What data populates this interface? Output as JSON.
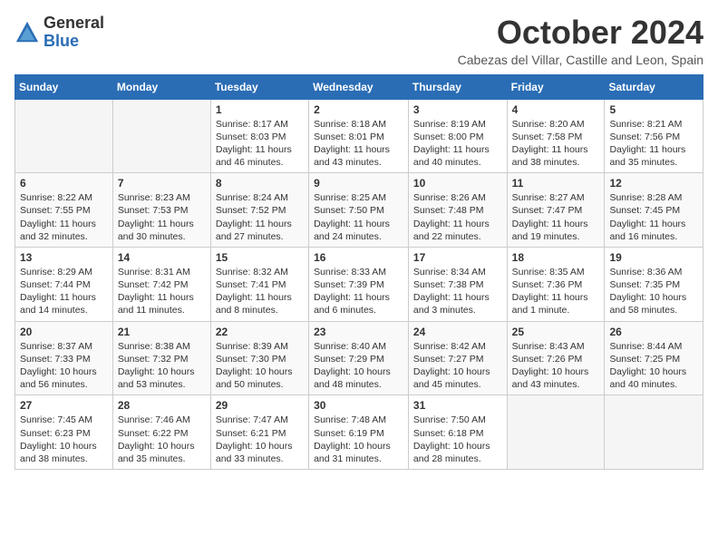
{
  "header": {
    "logo_general": "General",
    "logo_blue": "Blue",
    "month_title": "October 2024",
    "location": "Cabezas del Villar, Castille and Leon, Spain"
  },
  "days_of_week": [
    "Sunday",
    "Monday",
    "Tuesday",
    "Wednesday",
    "Thursday",
    "Friday",
    "Saturday"
  ],
  "weeks": [
    [
      {
        "day": "",
        "info": ""
      },
      {
        "day": "",
        "info": ""
      },
      {
        "day": "1",
        "info": "Sunrise: 8:17 AM\nSunset: 8:03 PM\nDaylight: 11 hours and 46 minutes."
      },
      {
        "day": "2",
        "info": "Sunrise: 8:18 AM\nSunset: 8:01 PM\nDaylight: 11 hours and 43 minutes."
      },
      {
        "day": "3",
        "info": "Sunrise: 8:19 AM\nSunset: 8:00 PM\nDaylight: 11 hours and 40 minutes."
      },
      {
        "day": "4",
        "info": "Sunrise: 8:20 AM\nSunset: 7:58 PM\nDaylight: 11 hours and 38 minutes."
      },
      {
        "day": "5",
        "info": "Sunrise: 8:21 AM\nSunset: 7:56 PM\nDaylight: 11 hours and 35 minutes."
      }
    ],
    [
      {
        "day": "6",
        "info": "Sunrise: 8:22 AM\nSunset: 7:55 PM\nDaylight: 11 hours and 32 minutes."
      },
      {
        "day": "7",
        "info": "Sunrise: 8:23 AM\nSunset: 7:53 PM\nDaylight: 11 hours and 30 minutes."
      },
      {
        "day": "8",
        "info": "Sunrise: 8:24 AM\nSunset: 7:52 PM\nDaylight: 11 hours and 27 minutes."
      },
      {
        "day": "9",
        "info": "Sunrise: 8:25 AM\nSunset: 7:50 PM\nDaylight: 11 hours and 24 minutes."
      },
      {
        "day": "10",
        "info": "Sunrise: 8:26 AM\nSunset: 7:48 PM\nDaylight: 11 hours and 22 minutes."
      },
      {
        "day": "11",
        "info": "Sunrise: 8:27 AM\nSunset: 7:47 PM\nDaylight: 11 hours and 19 minutes."
      },
      {
        "day": "12",
        "info": "Sunrise: 8:28 AM\nSunset: 7:45 PM\nDaylight: 11 hours and 16 minutes."
      }
    ],
    [
      {
        "day": "13",
        "info": "Sunrise: 8:29 AM\nSunset: 7:44 PM\nDaylight: 11 hours and 14 minutes."
      },
      {
        "day": "14",
        "info": "Sunrise: 8:31 AM\nSunset: 7:42 PM\nDaylight: 11 hours and 11 minutes."
      },
      {
        "day": "15",
        "info": "Sunrise: 8:32 AM\nSunset: 7:41 PM\nDaylight: 11 hours and 8 minutes."
      },
      {
        "day": "16",
        "info": "Sunrise: 8:33 AM\nSunset: 7:39 PM\nDaylight: 11 hours and 6 minutes."
      },
      {
        "day": "17",
        "info": "Sunrise: 8:34 AM\nSunset: 7:38 PM\nDaylight: 11 hours and 3 minutes."
      },
      {
        "day": "18",
        "info": "Sunrise: 8:35 AM\nSunset: 7:36 PM\nDaylight: 11 hours and 1 minute."
      },
      {
        "day": "19",
        "info": "Sunrise: 8:36 AM\nSunset: 7:35 PM\nDaylight: 10 hours and 58 minutes."
      }
    ],
    [
      {
        "day": "20",
        "info": "Sunrise: 8:37 AM\nSunset: 7:33 PM\nDaylight: 10 hours and 56 minutes."
      },
      {
        "day": "21",
        "info": "Sunrise: 8:38 AM\nSunset: 7:32 PM\nDaylight: 10 hours and 53 minutes."
      },
      {
        "day": "22",
        "info": "Sunrise: 8:39 AM\nSunset: 7:30 PM\nDaylight: 10 hours and 50 minutes."
      },
      {
        "day": "23",
        "info": "Sunrise: 8:40 AM\nSunset: 7:29 PM\nDaylight: 10 hours and 48 minutes."
      },
      {
        "day": "24",
        "info": "Sunrise: 8:42 AM\nSunset: 7:27 PM\nDaylight: 10 hours and 45 minutes."
      },
      {
        "day": "25",
        "info": "Sunrise: 8:43 AM\nSunset: 7:26 PM\nDaylight: 10 hours and 43 minutes."
      },
      {
        "day": "26",
        "info": "Sunrise: 8:44 AM\nSunset: 7:25 PM\nDaylight: 10 hours and 40 minutes."
      }
    ],
    [
      {
        "day": "27",
        "info": "Sunrise: 7:45 AM\nSunset: 6:23 PM\nDaylight: 10 hours and 38 minutes."
      },
      {
        "day": "28",
        "info": "Sunrise: 7:46 AM\nSunset: 6:22 PM\nDaylight: 10 hours and 35 minutes."
      },
      {
        "day": "29",
        "info": "Sunrise: 7:47 AM\nSunset: 6:21 PM\nDaylight: 10 hours and 33 minutes."
      },
      {
        "day": "30",
        "info": "Sunrise: 7:48 AM\nSunset: 6:19 PM\nDaylight: 10 hours and 31 minutes."
      },
      {
        "day": "31",
        "info": "Sunrise: 7:50 AM\nSunset: 6:18 PM\nDaylight: 10 hours and 28 minutes."
      },
      {
        "day": "",
        "info": ""
      },
      {
        "day": "",
        "info": ""
      }
    ]
  ]
}
